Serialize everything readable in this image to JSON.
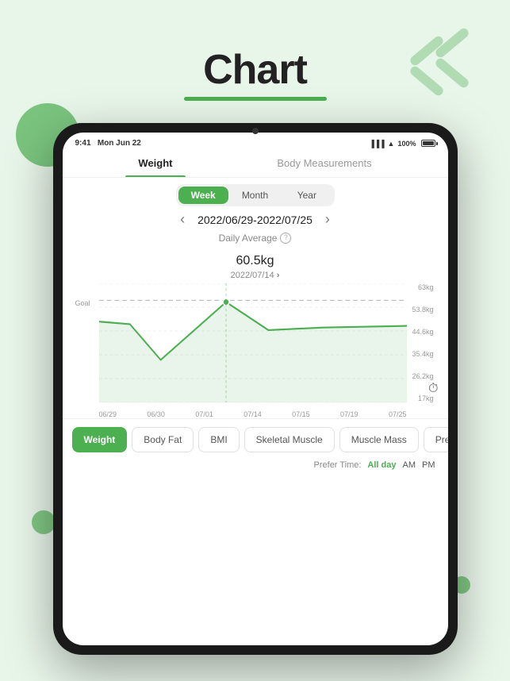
{
  "page": {
    "title": "Chart",
    "background_color": "#e8f5e9"
  },
  "tablet": {
    "status": {
      "time": "9:41",
      "date": "Mon Jun 22",
      "battery": "100%",
      "wifi": true,
      "signal": true
    },
    "tabs": [
      {
        "id": "weight",
        "label": "Weight",
        "active": true
      },
      {
        "id": "body-measurements",
        "label": "Body Measurements",
        "active": false
      }
    ],
    "period_options": [
      {
        "id": "week",
        "label": "Week",
        "active": true
      },
      {
        "id": "month",
        "label": "Month",
        "active": false
      },
      {
        "id": "year",
        "label": "Year",
        "active": false
      }
    ],
    "date_range": {
      "label": "2022/06/29-2022/07/25",
      "prev_arrow": "‹",
      "next_arrow": "›"
    },
    "daily_average": {
      "label": "Daily Average",
      "value": "60.5",
      "unit": "kg",
      "date": "2022/07/14",
      "date_arrow": "›"
    },
    "chart": {
      "y_labels": [
        "63kg",
        "53.8kg",
        "44.6kg",
        "35.4kg",
        "26.2kg",
        "17kg"
      ],
      "x_labels": [
        "06/29",
        "06/30",
        "07/01",
        "07/14",
        "07/15",
        "07/19",
        "07/25"
      ],
      "goal_label": "Goal"
    },
    "category_tabs": [
      {
        "id": "weight-cat",
        "label": "Weight",
        "active": true
      },
      {
        "id": "body-fat",
        "label": "Body Fat",
        "active": false
      },
      {
        "id": "bmi",
        "label": "BMI",
        "active": false
      },
      {
        "id": "skeletal-muscle",
        "label": "Skeletal Muscle",
        "active": false
      },
      {
        "id": "muscle-mass",
        "label": "Muscle Mass",
        "active": false
      },
      {
        "id": "prefer",
        "label": "Pre...",
        "active": false
      }
    ],
    "prefer_time": {
      "label": "Prefer Time:",
      "options": [
        {
          "id": "all-day",
          "label": "All day",
          "active": true
        },
        {
          "id": "am",
          "label": "AM",
          "active": false
        },
        {
          "id": "pm",
          "label": "PM",
          "active": false
        }
      ]
    }
  }
}
